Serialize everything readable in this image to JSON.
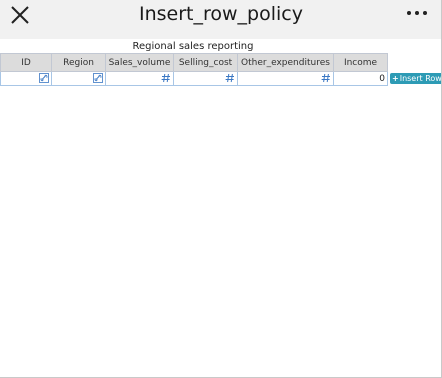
{
  "window": {
    "title": "Insert_row_policy"
  },
  "report": {
    "title": "Regional sales reporting"
  },
  "table": {
    "columns": [
      {
        "label": "ID",
        "type_icon": "link-icon"
      },
      {
        "label": "Region",
        "type_icon": "link-icon"
      },
      {
        "label": "Sales_volume",
        "type_icon": "hash-icon"
      },
      {
        "label": "Selling_cost",
        "type_icon": "hash-icon"
      },
      {
        "label": "Other_expenditures",
        "type_icon": "hash-icon"
      },
      {
        "label": "Income",
        "type_icon": ""
      }
    ],
    "rows": [
      {
        "income": "0"
      }
    ]
  },
  "actions": {
    "insert_row_plus": "+",
    "insert_row_label": "Insert Row"
  },
  "colors": {
    "accent": "#2d9bb5",
    "header_bg": "#f1f1f1",
    "column_header_bg": "#dcdcdc",
    "cell_border": "#a8c6e6",
    "icon_blue": "#3b78c4"
  }
}
